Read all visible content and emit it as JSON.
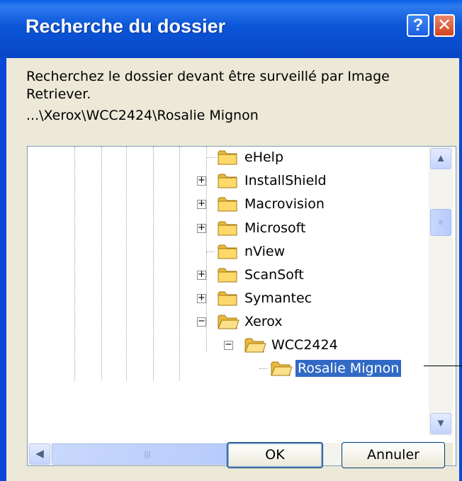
{
  "window": {
    "title": "Recherche du dossier",
    "help_button": "?",
    "close_button": "✕"
  },
  "dialog": {
    "description": "Recherchez le dossier devant être surveillé par Image Retriever.",
    "current_path": "...\\Xerox\\WCC2424\\Rosalie Mignon"
  },
  "tree": {
    "items": [
      {
        "label": "eHelp",
        "expander": ""
      },
      {
        "label": "InstallShield",
        "expander": "+"
      },
      {
        "label": "Macrovision",
        "expander": "+"
      },
      {
        "label": "Microsoft",
        "expander": "+"
      },
      {
        "label": "nView",
        "expander": ""
      },
      {
        "label": "ScanSoft",
        "expander": "+"
      },
      {
        "label": "Symantec",
        "expander": "+"
      },
      {
        "label": "Xerox",
        "expander": "−"
      },
      {
        "label": "WCC2424",
        "expander": "−"
      },
      {
        "label": "Rosalie Mignon",
        "expander": "",
        "selected": true
      }
    ]
  },
  "buttons": {
    "ok": "OK",
    "cancel": "Annuler"
  },
  "colors": {
    "title_bar": "#0a55d8",
    "selection": "#316ac5",
    "dialog_bg": "#ece9d8"
  }
}
